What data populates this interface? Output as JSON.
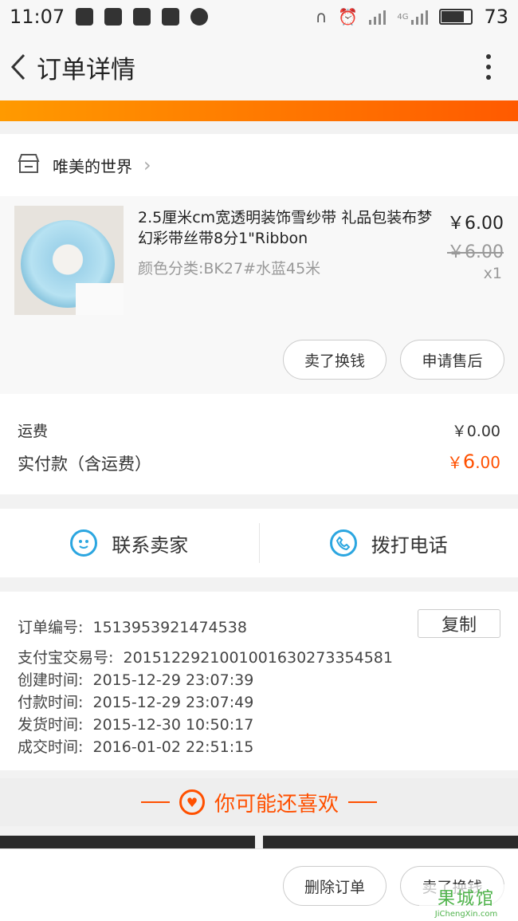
{
  "status_bar": {
    "time": "11:07",
    "network": "4G",
    "battery": "73"
  },
  "nav": {
    "title": "订单详情"
  },
  "shop": {
    "name": "唯美的世界"
  },
  "item": {
    "title": "2.5厘米cm宽透明装饰雪纱带 礼品包装布梦幻彩带丝带8分1\"Ribbon",
    "sku": "颜色分类:BK27#水蓝45米",
    "price": "￥6.00",
    "original_price": "￥6.00",
    "quantity": "x1",
    "btn_sell": "卖了换钱",
    "btn_aftersale": "申请售后"
  },
  "fees": {
    "shipping_label": "运费",
    "shipping_value": "￥0.00",
    "paid_label": "实付款（含运费）",
    "paid_symbol": "￥",
    "paid_int": "6",
    "paid_dec": ".00"
  },
  "contact": {
    "seller": "联系卖家",
    "call": "拨打电话"
  },
  "order_info": {
    "order_no_label": "订单编号:",
    "order_no": "1513953921474538",
    "copy": "复制",
    "alipay_label": "支付宝交易号:",
    "alipay_no": "2015122921001001630273354581",
    "created_label": "创建时间:",
    "created": "2015-12-29 23:07:39",
    "paid_label": "付款时间:",
    "paid": "2015-12-29 23:07:49",
    "shipped_label": "发货时间:",
    "shipped": "2015-12-30 10:50:17",
    "done_label": "成交时间:",
    "done": "2016-01-02 22:51:15"
  },
  "recommend": {
    "title": "你可能还喜欢"
  },
  "footer": {
    "delete": "删除订单",
    "sell": "卖了换钱"
  },
  "watermark": {
    "top": "果城馆",
    "bottom": "JiChengXin.com"
  },
  "colors": {
    "accent": "#ff5000",
    "link_blue": "#2ba6e0"
  }
}
